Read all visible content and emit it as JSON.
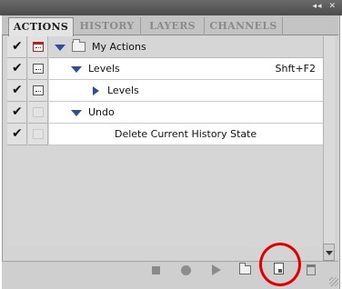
{
  "window": {
    "collapse_label": "◂◂",
    "close_label": "✕"
  },
  "tabs": [
    {
      "label": "ACTIONS",
      "active": true
    },
    {
      "label": "HISTORY",
      "active": false
    },
    {
      "label": "LAYERS",
      "active": false
    },
    {
      "label": "CHANNELS",
      "active": false
    }
  ],
  "panel_menu_icon": "panel-menu-icon",
  "actions": [
    {
      "label": "My Actions",
      "type": "set",
      "expanded": true,
      "checked": true,
      "dialog": "red-dialog-icon",
      "shortcut": ""
    },
    {
      "label": "Levels",
      "type": "action",
      "expanded": true,
      "checked": true,
      "dialog": "dialog-icon",
      "shortcut": "Shft+F2"
    },
    {
      "label": "Levels",
      "type": "command",
      "expanded": false,
      "checked": true,
      "dialog": "dialog-icon",
      "shortcut": ""
    },
    {
      "label": "Undo",
      "type": "action",
      "expanded": true,
      "checked": true,
      "dialog": "",
      "shortcut": ""
    },
    {
      "label": "Delete Current History State",
      "type": "command",
      "expanded": false,
      "checked": true,
      "dialog": "",
      "shortcut": ""
    }
  ],
  "bottom_toolbar": [
    {
      "name": "stop-icon"
    },
    {
      "name": "record-icon"
    },
    {
      "name": "play-icon"
    },
    {
      "name": "new-set-icon"
    },
    {
      "name": "new-action-icon"
    },
    {
      "name": "trash-icon"
    }
  ],
  "colors": {
    "highlight": "#e00000",
    "triangle": "#2c4f9a",
    "dialog_red": "#b22222"
  }
}
